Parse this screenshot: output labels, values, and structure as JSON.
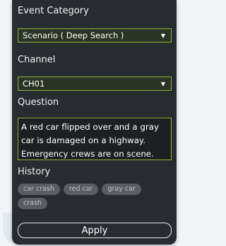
{
  "event_category": {
    "label": "Event Category",
    "selected": "Scenario ( Deep Search )",
    "caret": "▼"
  },
  "channel": {
    "label": "Channel",
    "selected": "CH01",
    "caret": "▼"
  },
  "question": {
    "label": "Question",
    "text": "A red car flipped over and a gray car is damaged on a highway. Emergency crews are on scene."
  },
  "history": {
    "label": "History",
    "items": [
      "car crash",
      "red car",
      "gray car",
      "crash"
    ]
  },
  "apply_label": "Apply",
  "colors": {
    "panel_bg": "#282b30",
    "accent_border": "#8fb23a",
    "chip_bg": "#5a5d62"
  }
}
